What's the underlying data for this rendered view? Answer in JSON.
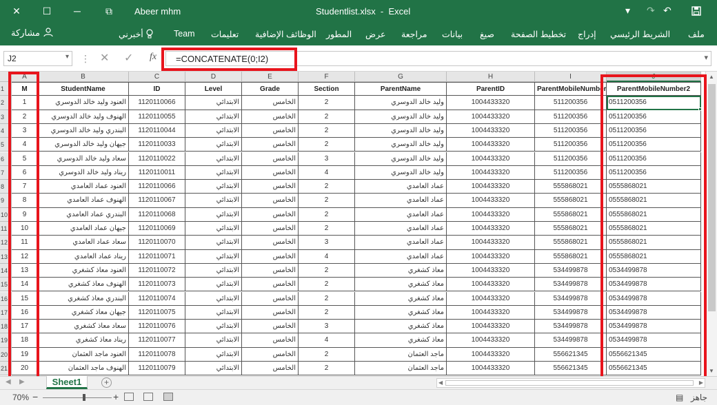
{
  "titlebar": {
    "user_name": "Abeer mhm",
    "document_title": "Studentlist.xlsx  -  Excel",
    "close_glyph": "✕",
    "restore_glyph": "☐",
    "ribbon_display_glyph": "⧉",
    "minimize_glyph": "─",
    "save_glyph": "💾",
    "undo_glyph": "↶",
    "redo_glyph": "↷",
    "qa_more_glyph": "▾"
  },
  "ribbon": {
    "share_label": "مشاركة",
    "tell_me_label": "أخبرني",
    "tabs": [
      "Team",
      "تعليمات",
      "الوظائف الإضافية",
      "المطور",
      "عرض",
      "مراجعة",
      "بيانات",
      "صيغ",
      "تخطيط الصفحة",
      "إدراج",
      "الشريط الرئيسي",
      "ملف"
    ]
  },
  "formula_bar": {
    "name_box": "J2",
    "formula": "=CONCATENATE(0;I2)",
    "fx": "fx",
    "cancel_glyph": "✕",
    "enter_glyph": "✓"
  },
  "sheet": {
    "columns": [
      "A",
      "B",
      "C",
      "D",
      "E",
      "F",
      "G",
      "H",
      "I",
      "J"
    ],
    "headers": [
      "M",
      "StudentName",
      "ID",
      "Level",
      "Grade",
      "Section",
      "ParentName",
      "ParentID",
      "ParentMobileNumber",
      "ParentMobileNumber2"
    ],
    "row_numbers": [
      "1",
      "2",
      "3",
      "4",
      "5",
      "6",
      "7",
      "8",
      "9",
      "10",
      "11",
      "12",
      "13",
      "14",
      "15",
      "16",
      "17",
      "18",
      "19",
      "20",
      "21"
    ],
    "rows": [
      [
        "1",
        "العنود وليد خالد الدوسري",
        "1120110066",
        "الابتدائي",
        "الخامس",
        "2",
        "وليد خالد الدوسري",
        "1004433320",
        "511200356",
        "0511200356"
      ],
      [
        "2",
        "الهنوف وليد خالد الدوسري",
        "1120110055",
        "الابتدائي",
        "الخامس",
        "2",
        "وليد خالد الدوسري",
        "1004433320",
        "511200356",
        "0511200356"
      ],
      [
        "3",
        "البندري وليد خالد الدوسري",
        "1120110044",
        "الابتدائي",
        "الخامس",
        "2",
        "وليد خالد الدوسري",
        "1004433320",
        "511200356",
        "0511200356"
      ],
      [
        "4",
        "جيهان وليد خالد الدوسري",
        "1120110033",
        "الابتدائي",
        "الخامس",
        "2",
        "وليد خالد الدوسري",
        "1004433320",
        "511200356",
        "0511200356"
      ],
      [
        "5",
        "سعاد وليد خالد الدوسري",
        "1120110022",
        "الابتدائي",
        "الخامس",
        "3",
        "وليد خالد الدوسري",
        "1004433320",
        "511200356",
        "0511200356"
      ],
      [
        "6",
        "ريناد وليد خالد الدوسري",
        "1120110011",
        "الابتدائي",
        "الخامس",
        "4",
        "وليد خالد الدوسري",
        "1004433320",
        "511200356",
        "0511200356"
      ],
      [
        "7",
        "العنود عماد العامدي",
        "1120110066",
        "الابتدائي",
        "الخامس",
        "2",
        "عماد العامدي",
        "1004433320",
        "555868021",
        "0555868021"
      ],
      [
        "8",
        "الهنوف عماد العامدي",
        "1120110067",
        "الابتدائي",
        "الخامس",
        "2",
        "عماد العامدي",
        "1004433320",
        "555868021",
        "0555868021"
      ],
      [
        "9",
        "البندري عماد العامدي",
        "1120110068",
        "الابتدائي",
        "الخامس",
        "2",
        "عماد العامدي",
        "1004433320",
        "555868021",
        "0555868021"
      ],
      [
        "10",
        "جيهان عماد العامدي",
        "1120110069",
        "الابتدائي",
        "الخامس",
        "2",
        "عماد العامدي",
        "1004433320",
        "555868021",
        "0555868021"
      ],
      [
        "11",
        "سعاد عماد العامدي",
        "1120110070",
        "الابتدائي",
        "الخامس",
        "3",
        "عماد العامدي",
        "1004433320",
        "555868021",
        "0555868021"
      ],
      [
        "12",
        "ريناد عماد العامدي",
        "1120110071",
        "الابتدائي",
        "الخامس",
        "4",
        "عماد العامدي",
        "1004433320",
        "555868021",
        "0555868021"
      ],
      [
        "13",
        "العنود معاذ كشغري",
        "1120110072",
        "الابتدائي",
        "الخامس",
        "2",
        "معاذ كشغري",
        "1004433320",
        "534499878",
        "0534499878"
      ],
      [
        "14",
        "الهنوف معاذ كشغري",
        "1120110073",
        "الابتدائي",
        "الخامس",
        "2",
        "معاذ كشغري",
        "1004433320",
        "534499878",
        "0534499878"
      ],
      [
        "15",
        "البندري معاذ كشغري",
        "1120110074",
        "الابتدائي",
        "الخامس",
        "2",
        "معاذ كشغري",
        "1004433320",
        "534499878",
        "0534499878"
      ],
      [
        "16",
        "جيهان معاذ كشغري",
        "1120110075",
        "الابتدائي",
        "الخامس",
        "2",
        "معاذ كشغري",
        "1004433320",
        "534499878",
        "0534499878"
      ],
      [
        "17",
        "سعاد معاذ كشغري",
        "1120110076",
        "الابتدائي",
        "الخامس",
        "3",
        "معاذ كشغري",
        "1004433320",
        "534499878",
        "0534499878"
      ],
      [
        "18",
        "ريناد معاذ كشغري",
        "1120110077",
        "الابتدائي",
        "الخامس",
        "4",
        "معاذ كشغري",
        "1004433320",
        "534499878",
        "0534499878"
      ],
      [
        "19",
        "العنود ماجد العثمان",
        "1120110078",
        "الابتدائي",
        "الخامس",
        "2",
        "ماجد العثمان",
        "1004433320",
        "556621345",
        "0556621345"
      ],
      [
        "20",
        "الهنوف ماجد العثمان",
        "1120110079",
        "الابتدائي",
        "الخامس",
        "2",
        "ماجد العثمان",
        "1004433320",
        "556621345",
        "0556621345"
      ]
    ]
  },
  "sheet_tabs": {
    "active": "Sheet1",
    "add_glyph": "+"
  },
  "status_bar": {
    "zoom": "70%",
    "ready": "جاهز",
    "minus": "−",
    "plus": "+"
  },
  "colors": {
    "excel_green": "#217346",
    "highlight_red": "#e8141c"
  }
}
